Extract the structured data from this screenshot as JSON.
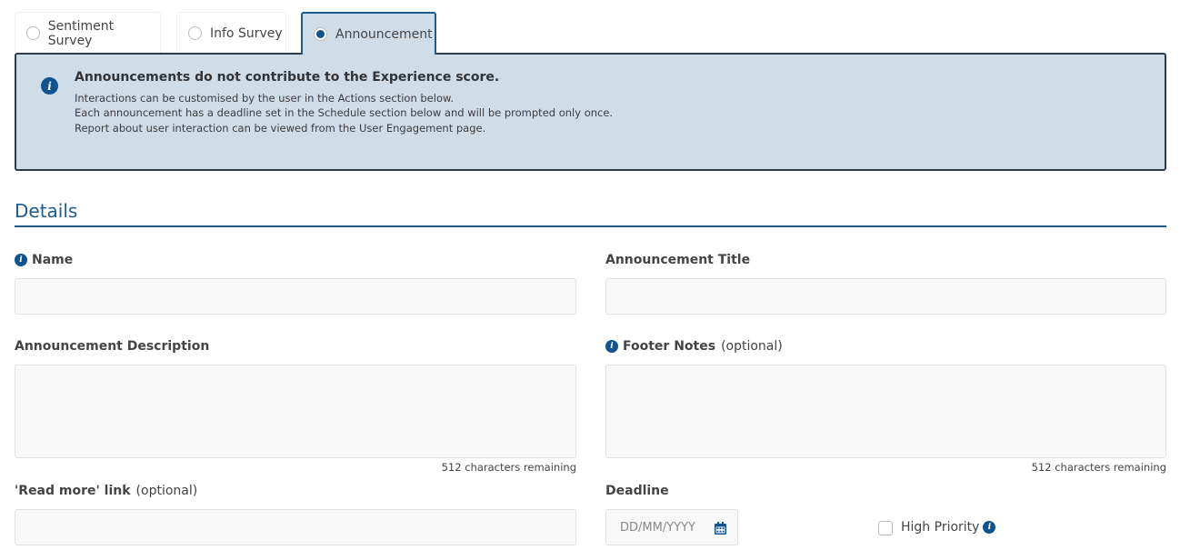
{
  "tabs": [
    {
      "label": "Sentiment Survey",
      "selected": false
    },
    {
      "label": "Info Survey",
      "selected": false
    },
    {
      "label": "Announcement",
      "selected": true
    }
  ],
  "banner": {
    "icon": "info-icon",
    "title": "Announcements do not contribute to the Experience score.",
    "lines": [
      "Interactions can be customised by the user in the Actions section below.",
      "Each announcement has a deadline set in the Schedule section below and will be prompted only once.",
      "Report about user interaction can be viewed from the User Engagement page."
    ]
  },
  "section": {
    "title": "Details"
  },
  "fields": {
    "name": {
      "label": "Name",
      "value": "",
      "has_info": true
    },
    "announcement_title": {
      "label": "Announcement Title",
      "value": ""
    },
    "description": {
      "label": "Announcement Description",
      "value": "",
      "remaining": "512 characters remaining"
    },
    "footer_notes": {
      "label": "Footer Notes",
      "optional": "(optional)",
      "value": "",
      "has_info": true,
      "remaining": "512 characters remaining"
    },
    "read_more": {
      "label": "'Read more' link",
      "optional": "(optional)",
      "value": ""
    },
    "deadline": {
      "label": "Deadline",
      "placeholder": "DD/MM/YYYY",
      "icon": "calendar-icon"
    },
    "high_priority": {
      "label": "High Priority",
      "checked": false,
      "has_info": true
    }
  },
  "colors": {
    "accent": "#0f5490",
    "banner_bg": "#cfdde9",
    "banner_border": "#2d3a4a"
  }
}
